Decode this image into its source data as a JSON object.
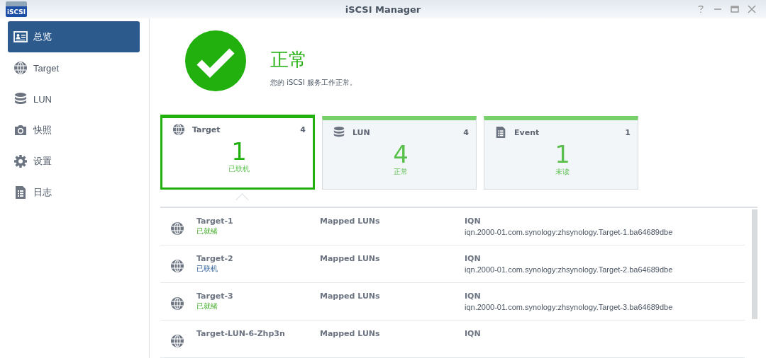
{
  "window": {
    "title": "iSCSI Manager",
    "app_icon_text": "iSCSI"
  },
  "sidebar": {
    "items": [
      {
        "label": "总览",
        "kind": "overview",
        "selected": true
      },
      {
        "label": "Target",
        "kind": "globe",
        "selected": false
      },
      {
        "label": "LUN",
        "kind": "database",
        "selected": false
      },
      {
        "label": "快照",
        "kind": "camera",
        "selected": false
      },
      {
        "label": "设置",
        "kind": "gear",
        "selected": false
      },
      {
        "label": "日志",
        "kind": "log",
        "selected": false
      }
    ]
  },
  "status": {
    "title": "正常",
    "message": "您的 iSCSI 服务工作正常。"
  },
  "cards": [
    {
      "kind": "globe",
      "title": "Target",
      "total": "4",
      "count": "1",
      "caption": "已联机",
      "selected": true
    },
    {
      "kind": "database",
      "title": "LUN",
      "total": "4",
      "count": "4",
      "caption": "正常",
      "selected": false
    },
    {
      "kind": "log",
      "title": "Event",
      "total": "1",
      "count": "1",
      "caption": "未读",
      "selected": false
    }
  ],
  "targets": [
    {
      "name": "Target-1",
      "status": "已就绪",
      "kind": "ready",
      "luns_label": "Mapped LUNs",
      "iqn_label": "IQN",
      "iqn": "iqn.2000-01.com.synology:zhsynology.Target-1.ba64689dbe"
    },
    {
      "name": "Target-2",
      "status": "已联机",
      "kind": "connected",
      "luns_label": "Mapped LUNs",
      "iqn_label": "IQN",
      "iqn": "iqn.2000-01.com.synology:zhsynology.Target-2.ba64689dbe"
    },
    {
      "name": "Target-3",
      "status": "已就绪",
      "kind": "ready",
      "luns_label": "Mapped LUNs",
      "iqn_label": "IQN",
      "iqn": "iqn.2000-01.com.synology:zhsynology.Target-3.ba64689dbe"
    },
    {
      "name": "Target-LUN-6-Zhp3n",
      "luns_label": "Mapped LUNs",
      "iqn_label": "IQN"
    }
  ]
}
